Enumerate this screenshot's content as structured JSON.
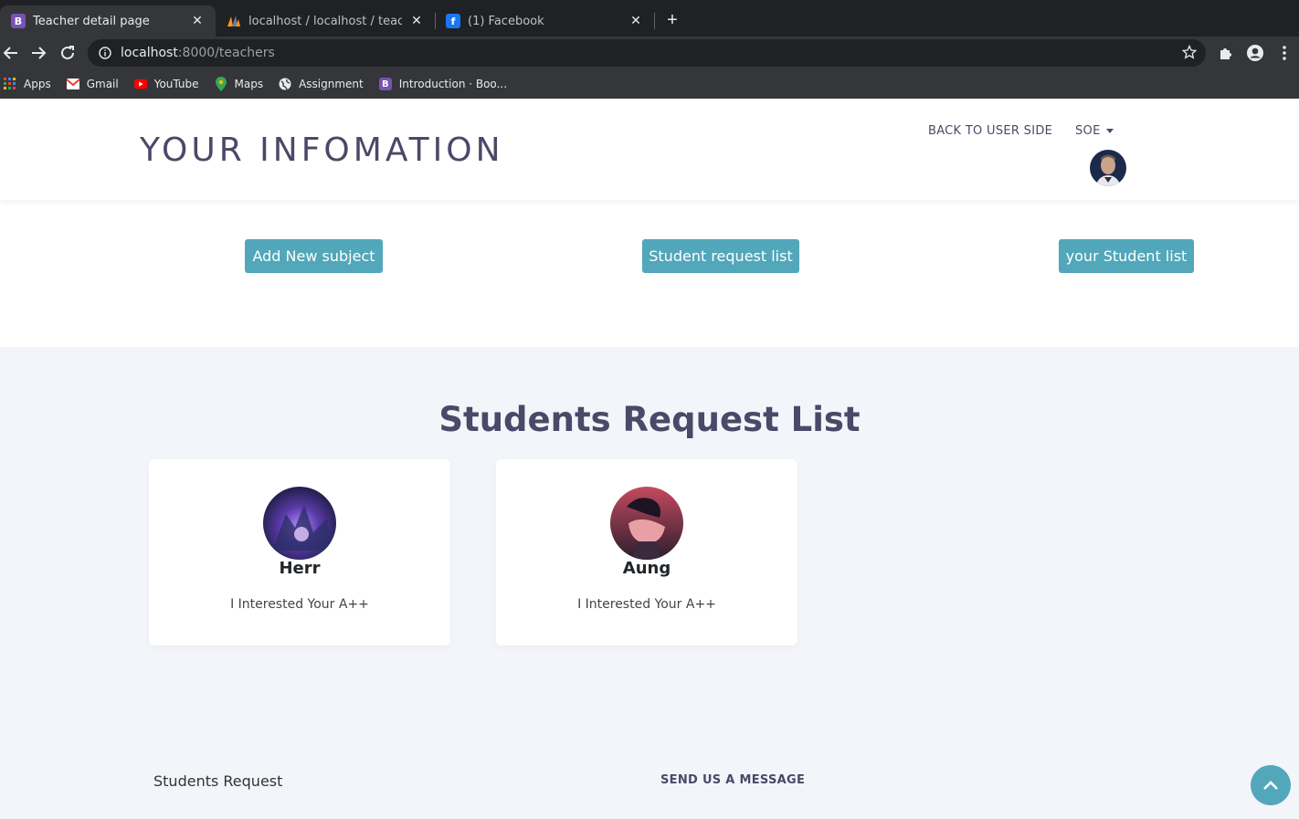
{
  "browser": {
    "tabs": [
      {
        "title": "Teacher detail page",
        "favicon": "B",
        "active": true
      },
      {
        "title": "localhost / localhost / teacher /",
        "favicon": "phpmyadmin",
        "active": false
      },
      {
        "title": "(1) Facebook",
        "favicon": "f",
        "active": false
      }
    ],
    "close_glyph": "✕",
    "new_tab_glyph": "+",
    "url_host": "localhost",
    "url_path": ":8000/teachers",
    "bookmarks": [
      {
        "label": "Apps",
        "icon": "apps-grid-icon"
      },
      {
        "label": "Gmail",
        "icon": "gmail-icon"
      },
      {
        "label": "YouTube",
        "icon": "youtube-icon"
      },
      {
        "label": "Maps",
        "icon": "maps-pin-icon"
      },
      {
        "label": "Assignment",
        "icon": "globe-icon"
      },
      {
        "label": "Introduction · Boo...",
        "icon": "bootstrap-icon"
      }
    ]
  },
  "header": {
    "brand": "YOUR INFOMATION",
    "nav_back": "BACK TO USER SIDE",
    "nav_user": "SOE"
  },
  "actions": {
    "add_subject": "Add New subject",
    "request_list": "Student request list",
    "student_list": "your Student list"
  },
  "requests": {
    "title": "Students Request List",
    "cards": [
      {
        "name": "Herr",
        "message": "I Interested Your A++"
      },
      {
        "name": "Aung",
        "message": "I Interested Your A++"
      }
    ]
  },
  "footer": {
    "left_title": "Students Request",
    "right_title": "SEND US A MESSAGE"
  },
  "colors": {
    "accent": "#52a7ba",
    "heading": "#4b4868",
    "section_bg": "#f3f5fa"
  }
}
